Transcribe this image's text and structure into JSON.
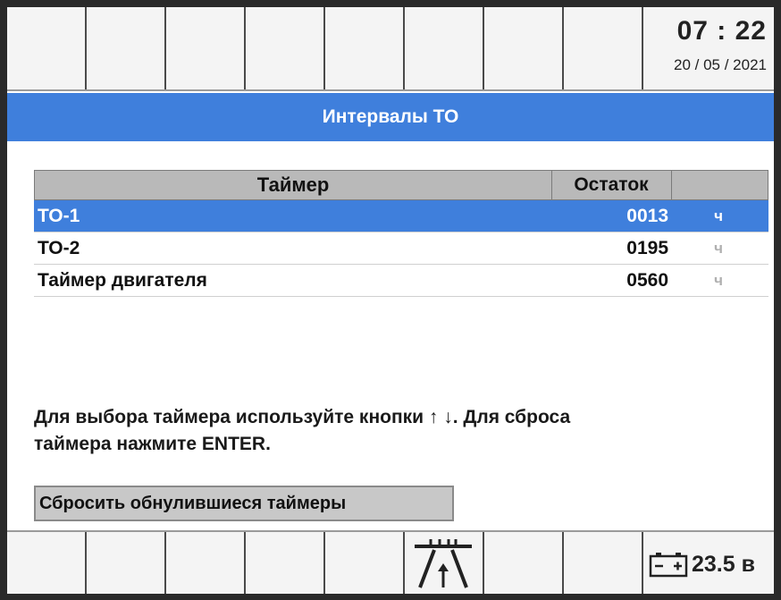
{
  "header": {
    "time": "07 : 22",
    "date": "20 / 05 / 2021"
  },
  "title": "Интервалы ТО",
  "table": {
    "columns": [
      "Таймер",
      "Остаток",
      ""
    ],
    "rows": [
      {
        "name": "ТО-1",
        "value": "0013",
        "unit": "ч",
        "selected": true
      },
      {
        "name": "ТО-2",
        "value": "0195",
        "unit": "ч",
        "selected": false
      },
      {
        "name": "Таймер двигателя",
        "value": "0560",
        "unit": "ч",
        "selected": false
      }
    ]
  },
  "hint": {
    "line1": "Для выбора таймера используйте кнопки ↑ ↓. Для сброса",
    "line2": "таймера нажмите ENTER."
  },
  "reset_button": "Сбросить обнулившиеся таймеры",
  "footer": {
    "voltage": "23.5 в",
    "icons": [
      "road-icon",
      "battery-icon"
    ]
  },
  "colors": {
    "accent": "#3f7fdc",
    "header_bg": "#b9b9b9",
    "button_bg": "#c8c8c8"
  }
}
